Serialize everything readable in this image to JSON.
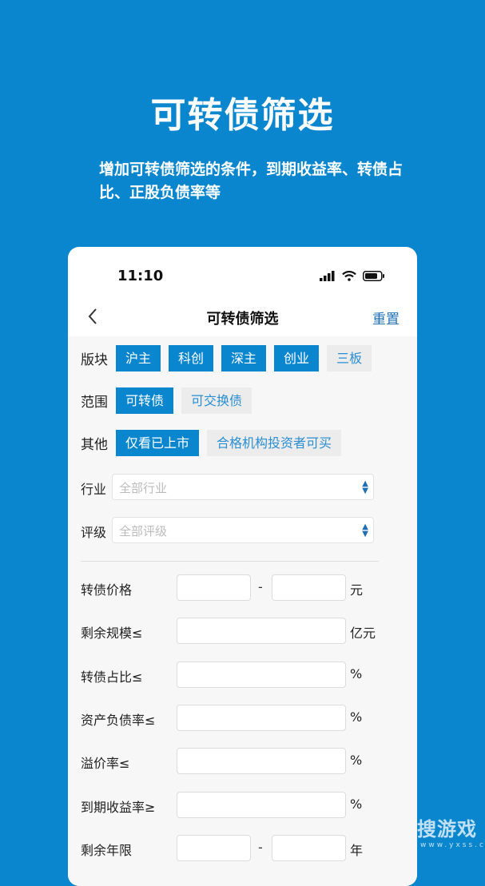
{
  "hero": {
    "title": "可转债筛选",
    "subtitle": "增加可转债筛选的条件，到期收益率、转债占比、正股负债率等"
  },
  "status_bar": {
    "time": "11:10"
  },
  "nav": {
    "title": "可转债筛选",
    "reset_label": "重置"
  },
  "filters": {
    "sector": {
      "label": "版块",
      "options": [
        {
          "label": "沪主",
          "selected": true
        },
        {
          "label": "科创",
          "selected": true
        },
        {
          "label": "深主",
          "selected": true
        },
        {
          "label": "创业",
          "selected": true
        },
        {
          "label": "三板",
          "selected": false
        }
      ]
    },
    "scope": {
      "label": "范围",
      "options": [
        {
          "label": "可转债",
          "selected": true
        },
        {
          "label": "可交换债",
          "selected": false
        }
      ]
    },
    "other": {
      "label": "其他",
      "options": [
        {
          "label": "仅看已上市",
          "selected": true
        },
        {
          "label": "合格机构投资者可买",
          "selected": false
        }
      ]
    },
    "industry": {
      "label": "行业",
      "placeholder": "全部行业"
    },
    "rating": {
      "label": "评级",
      "placeholder": "全部评级"
    }
  },
  "ranges": {
    "price": {
      "label": "转债价格",
      "unit": "元",
      "dash": "-"
    },
    "scale": {
      "label": "剩余规模≤",
      "unit": "亿元"
    },
    "ratio": {
      "label": "转债占比≤",
      "unit": "%"
    },
    "debt": {
      "label": "资产负债率≤",
      "unit": "%"
    },
    "premium": {
      "label": "溢价率≤",
      "unit": "%"
    },
    "ytm": {
      "label": "到期收益率≥",
      "unit": "%"
    },
    "term": {
      "label": "剩余年限",
      "unit": "年",
      "dash": "-"
    }
  },
  "watermark": {
    "main": "搜游戏",
    "sub": "www.yxss.com"
  },
  "colors": {
    "primary": "#0a86cf",
    "chip_inactive": "#ececec",
    "link": "#1f6fb5"
  }
}
